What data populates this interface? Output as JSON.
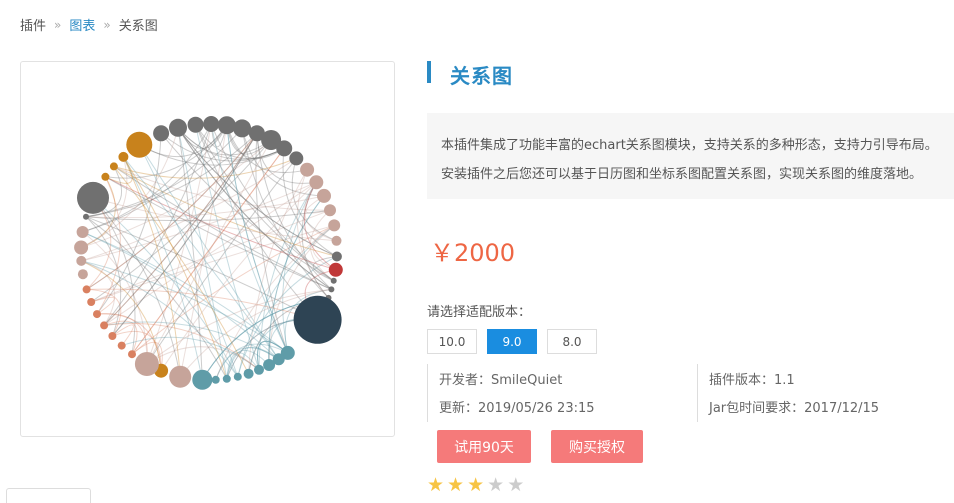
{
  "breadcrumb": {
    "home": "插件",
    "category": "图表",
    "current": "关系图"
  },
  "product": {
    "title": "关系图",
    "description": [
      "本插件集成了功能丰富的echart关系图模块，支持关系的多种形态，支持力引导布局。",
      "安装插件之后您还可以基于日历图和坐标系图配置关系图，实现关系图的维度落地。"
    ],
    "price": "￥2000"
  },
  "version_select": {
    "label": "请选择适配版本：",
    "options": [
      "10.0",
      "9.0",
      "8.0"
    ],
    "selected": "9.0"
  },
  "info": {
    "developer": "开发者：SmileQuiet",
    "plugin_version": "插件版本：1.1",
    "updated": "更新：2019/05/26 23:15",
    "jar_time": "Jar包时间要求：2017/12/15"
  },
  "actions": {
    "trial": "试用90天",
    "buy": "购买授权"
  },
  "rating": {
    "value": 3,
    "max": 5
  },
  "colors": {
    "accent": "#2a8ac4",
    "price": "#ee6644",
    "button": "#f57a7a",
    "version_active": "#1a8de0",
    "graph_nodes": [
      "#707070",
      "#c8821c",
      "#c6a49a",
      "#d98060",
      "#c03838",
      "#2e4454",
      "#5f9ca8"
    ]
  },
  "icons": {
    "star": "star-icon",
    "separator": "chevron-double-right-icon"
  }
}
